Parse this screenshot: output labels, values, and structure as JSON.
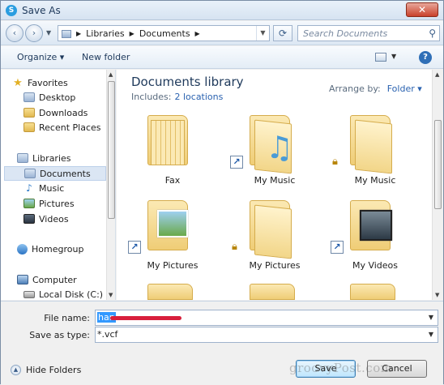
{
  "window": {
    "title": "Save As",
    "close_symbol": "✕"
  },
  "nav": {
    "back_symbol": "‹",
    "forward_symbol": "›",
    "breadcrumbs": [
      "Libraries",
      "Documents"
    ],
    "refresh_symbol": "⟳",
    "search_placeholder": "Search Documents"
  },
  "toolbar": {
    "organize": "Organize ▾",
    "new_folder": "New folder",
    "help": "?"
  },
  "sidebar": {
    "favorites_header": "Favorites",
    "favorites": [
      "Desktop",
      "Downloads",
      "Recent Places"
    ],
    "libraries_header": "Libraries",
    "libraries": [
      "Documents",
      "Music",
      "Pictures",
      "Videos"
    ],
    "selected": "Documents",
    "homegroup": "Homegroup",
    "computer_header": "Computer",
    "drives": [
      "Local Disk (C:)"
    ]
  },
  "content": {
    "library_title": "Documents library",
    "includes_label": "Includes:",
    "includes_link": "2 locations",
    "arrange_label": "Arrange by:",
    "arrange_value": "Folder ▾",
    "folders": [
      {
        "label": "Fax",
        "badge": "none",
        "kind": "stack"
      },
      {
        "label": "My Music",
        "badge": "shortcut",
        "kind": "music"
      },
      {
        "label": "My Music",
        "badge": "lock",
        "kind": "plain"
      },
      {
        "label": "My Pictures",
        "badge": "shortcut",
        "kind": "photo"
      },
      {
        "label": "My Pictures",
        "badge": "lock",
        "kind": "plain"
      },
      {
        "label": "My Videos",
        "badge": "shortcut",
        "kind": "film"
      }
    ]
  },
  "form": {
    "file_name_label": "File name:",
    "file_name_value": "han",
    "save_type_label": "Save as type:",
    "save_type_value": "*.vcf",
    "hide_folders": "Hide Folders",
    "save_button": "Save",
    "cancel_button": "Cancel"
  },
  "watermark": "groovyPost.com"
}
